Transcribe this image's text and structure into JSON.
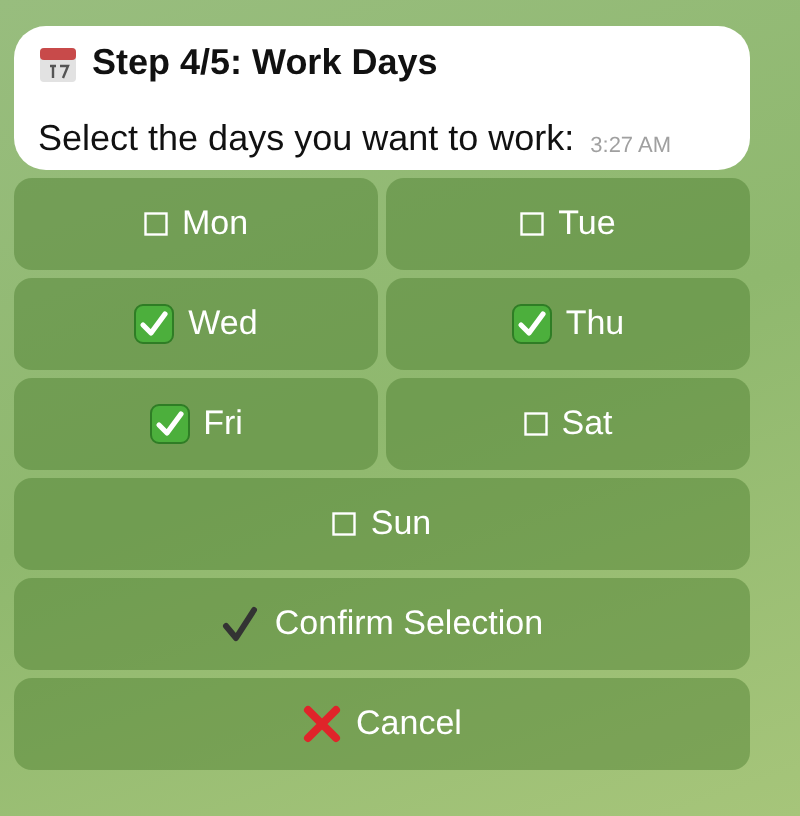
{
  "message": {
    "title": "Step 4/5: Work Days",
    "text": "Select the days you want to work:",
    "time": "3:27 AM"
  },
  "day_buttons": [
    {
      "label": "Mon",
      "checked": false
    },
    {
      "label": "Tue",
      "checked": false
    },
    {
      "label": "Wed",
      "checked": true
    },
    {
      "label": "Thu",
      "checked": true
    },
    {
      "label": "Fri",
      "checked": true
    },
    {
      "label": "Sat",
      "checked": false
    },
    {
      "label": "Sun",
      "checked": false
    }
  ],
  "action_buttons": [
    {
      "kind": "confirm",
      "label": "Confirm Selection"
    },
    {
      "kind": "cancel",
      "label": "Cancel"
    }
  ]
}
